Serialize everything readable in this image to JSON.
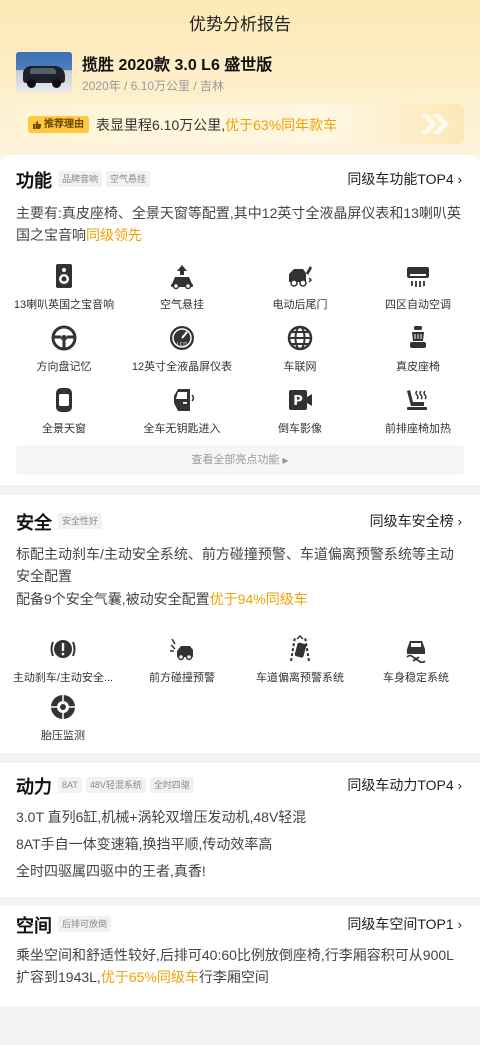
{
  "page": {
    "title": "优势分析报告"
  },
  "car": {
    "name": "揽胜 2020款 3.0 L6 盛世版",
    "meta": "2020年 / 6.10万公里 / 吉林"
  },
  "reason": {
    "tag": "推荐理由",
    "text_plain": "表显里程6.10万公里,",
    "text_highlight": "优于63%同年款车"
  },
  "function": {
    "title": "功能",
    "tags": [
      "品牌音响",
      "空气悬挂"
    ],
    "link": "同级车功能TOP4",
    "desc_plain": "主要有:真皮座椅、全景天窗等配置,其中12英寸全液晶屏仪表和13喇叭英国之宝音响",
    "desc_highlight": "同级领先",
    "features": [
      {
        "label": "13喇叭英国之宝音响",
        "icon": "speaker-icon"
      },
      {
        "label": "空气悬挂",
        "icon": "air-suspension-icon"
      },
      {
        "label": "电动后尾门",
        "icon": "tailgate-icon"
      },
      {
        "label": "四区自动空调",
        "icon": "air-conditioner-icon"
      },
      {
        "label": "方向盘记忆",
        "icon": "steering-wheel-icon"
      },
      {
        "label": "12英寸全液晶屏仪表",
        "icon": "lcd-gauge-icon"
      },
      {
        "label": "车联网",
        "icon": "globe-icon"
      },
      {
        "label": "真皮座椅",
        "icon": "seat-icon"
      },
      {
        "label": "全景天窗",
        "icon": "sunroof-icon"
      },
      {
        "label": "全车无钥匙进入",
        "icon": "keyless-door-icon"
      },
      {
        "label": "倒车影像",
        "icon": "reverse-camera-icon"
      },
      {
        "label": "前排座椅加热",
        "icon": "seat-heating-icon"
      }
    ],
    "view_all": "查看全部亮点功能"
  },
  "safety": {
    "title": "安全",
    "tags": [
      "安全性好"
    ],
    "link": "同级车安全榜",
    "desc1": "标配主动刹车/主动安全系统、前方碰撞预警、车道偏离预警系统等主动安全配置",
    "desc2_plain": "配备9个安全气囊,被动安全配置",
    "desc2_highlight": "优于94%同级车",
    "features": [
      {
        "label": "主动刹车/主动安全...",
        "icon": "brake-warning-icon"
      },
      {
        "label": "前方碰撞预警",
        "icon": "collision-warning-icon"
      },
      {
        "label": "车道偏离预警系统",
        "icon": "lane-departure-icon"
      },
      {
        "label": "车身稳定系统",
        "icon": "stability-control-icon"
      },
      {
        "label": "胎压监测",
        "icon": "tire-pressure-icon"
      }
    ]
  },
  "power": {
    "title": "动力",
    "tags": [
      "8AT",
      "48V轻混系统",
      "全时四驱"
    ],
    "link": "同级车动力TOP4",
    "lines": [
      "3.0T 直列6缸,机械+涡轮双增压发动机,48V轻混",
      "8AT手自一体变速箱,换挡平顺,传动效率高",
      "全时四驱属四驱中的王者,真香!"
    ]
  },
  "space": {
    "title": "空间",
    "tags": [
      "后排可放倒"
    ],
    "link": "同级车空间TOP1",
    "desc_plain": "乘坐空间和舒适性较好,后排可40:60比例放倒座椅,行李厢容积可从900L扩容到1943L,",
    "desc_highlight": "优于65%同级车",
    "desc_tail": "行李厢空间"
  },
  "colors": {
    "accent": "#f0a200",
    "tag_bg": "#ffc83d",
    "hero_bg": "#fde9b4"
  }
}
